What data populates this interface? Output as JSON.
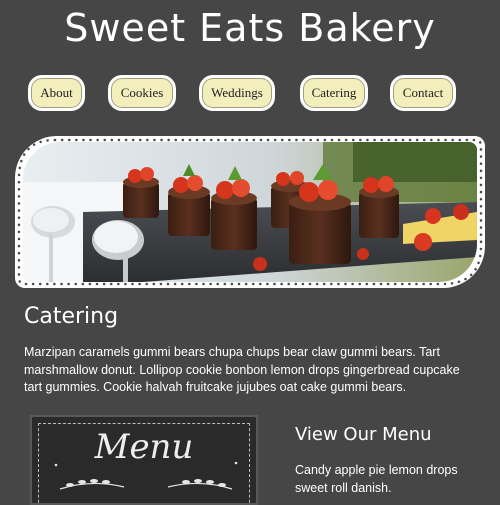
{
  "header": {
    "title": "Sweet Eats Bakery"
  },
  "nav": {
    "items": [
      {
        "label": "About"
      },
      {
        "label": "Cookies"
      },
      {
        "label": "Weddings"
      },
      {
        "label": "Catering"
      },
      {
        "label": "Contact"
      }
    ]
  },
  "hero": {
    "image_subject": "chocolate strawberry mini cakes on serving tray"
  },
  "catering": {
    "title": "Catering",
    "paragraph": "Marzipan caramels gummi bears chupa chups bear claw gummi bears. Tart marshmallow donut. Lollipop cookie bonbon lemon drops gingerbread cupcake tart gummies. Cookie halvah fruitcake jujubes oat cake gummi bears."
  },
  "menu_board": {
    "label": "Menu"
  },
  "view_menu": {
    "title": "View Our Menu",
    "paragraph": "Candy apple pie lemon drops sweet roll danish."
  },
  "colors": {
    "background": "#464646",
    "nav_button": "#f3efbd",
    "text": "#ffffff"
  }
}
